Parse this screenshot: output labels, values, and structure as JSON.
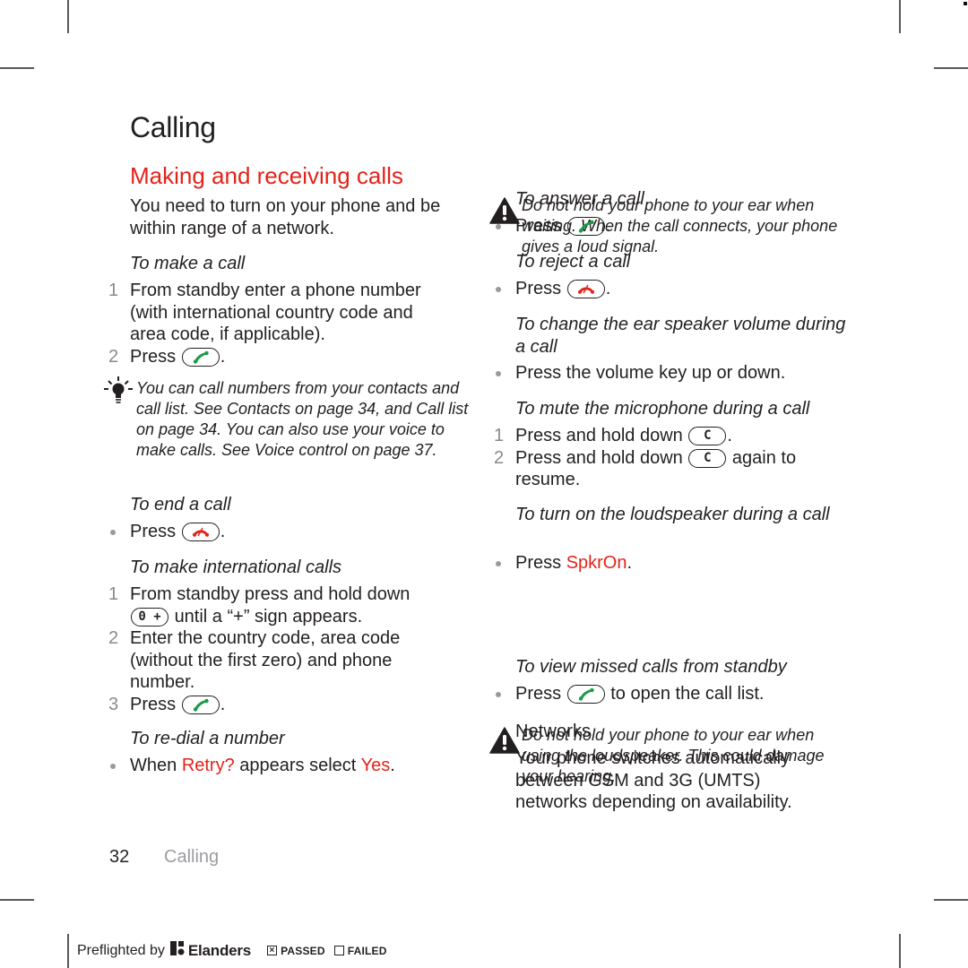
{
  "page": {
    "chapter_title": "Calling",
    "section_title": "Making and receiving calls",
    "intro": "You need to turn on your phone and be within range of a network."
  },
  "left": {
    "make_call": {
      "heading": "To make a call",
      "steps": [
        {
          "num": "1",
          "text": "From standby enter a phone number (with international country code and area code, if applicable)."
        },
        {
          "num": "2",
          "pre": "Press",
          "key": "call-key",
          "post": "."
        }
      ],
      "tip": "You can call numbers from your contacts and call list. See Contacts on page 34, and Call list on page 34. You can also use your voice to make calls. See Voice control on page 37."
    },
    "end_call": {
      "heading": "To end a call",
      "bullet": {
        "pre": "Press",
        "key": "end-key",
        "post": "."
      }
    },
    "intl_calls": {
      "heading": "To make international calls",
      "steps": [
        {
          "num": "1",
          "text_a": "From standby press and hold down",
          "key_label": "0 +",
          "text_b": "until a “+” sign appears."
        },
        {
          "num": "2",
          "text": "Enter the country code, area code (without the first zero) and phone number."
        },
        {
          "num": "3",
          "pre": "Press",
          "key": "call-key",
          "post": "."
        }
      ]
    },
    "redial": {
      "heading": "To re-dial a number",
      "bullet": {
        "a": "When ",
        "retry": "Retry?",
        "b": " appears select ",
        "yes": "Yes",
        "c": "."
      }
    }
  },
  "right": {
    "warning_1": "Do not hold your phone to your ear when waiting. When the call connects, your phone gives a loud signal.",
    "answer": {
      "heading": "To answer a call",
      "bullet": {
        "pre": "Press",
        "key": "call-key",
        "post": "."
      }
    },
    "reject": {
      "heading": "To reject a call",
      "bullet": {
        "pre": "Press",
        "key": "end-key",
        "post": "."
      }
    },
    "volume": {
      "heading": "To change the ear speaker volume during a call",
      "bullet": "Press the volume key up or down."
    },
    "mute": {
      "heading": "To mute the microphone during a call",
      "steps": [
        {
          "num": "1",
          "pre": "Press and hold down",
          "key_label": "C",
          "post": "."
        },
        {
          "num": "2",
          "pre": "Press and hold down",
          "key_label": "C",
          "post": " again to resume."
        }
      ]
    },
    "loudspeaker": {
      "heading": "To turn on the loudspeaker during a call",
      "bullet": {
        "pre": "Press ",
        "softkey": "SpkrOn",
        "post": "."
      }
    },
    "warning_2": "Do not hold your phone to your ear when using the loudspeaker. This could damage your hearing.",
    "missed": {
      "heading": "To view missed calls from standby",
      "bullet": {
        "pre": "Press",
        "key": "call-key",
        "post": " to open the call list."
      }
    },
    "networks": {
      "heading": "Networks",
      "text": "Your phone switches automatically between GSM and 3G (UMTS) networks depending on availability."
    }
  },
  "footer": {
    "page_number": "32",
    "chapter": "Calling"
  },
  "preflight": {
    "label": "Preflighted by",
    "brand": "Elanders",
    "passed_label": "PASSED",
    "failed_label": "FAILED",
    "passed_checked": true,
    "failed_checked": false
  },
  "colors": {
    "accent_red": "#e2231a",
    "call_green": "#1a9a4a",
    "text": "#231f20",
    "muted": "#9a9ca0"
  }
}
